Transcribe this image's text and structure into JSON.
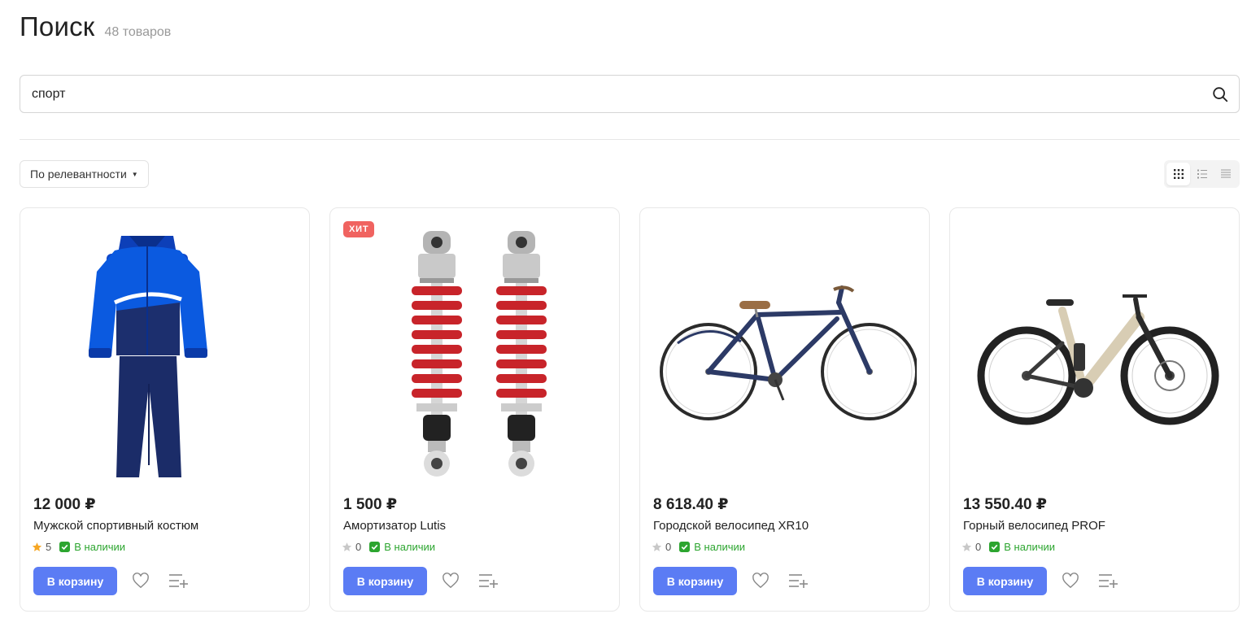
{
  "header": {
    "title": "Поиск",
    "count": "48 товаров"
  },
  "search": {
    "value": "спорт",
    "icon": "search-icon"
  },
  "toolbar": {
    "sort_label": "По релевантности",
    "views": [
      "grid-view-icon",
      "list-view-icon",
      "compact-view-icon"
    ],
    "active_view": "grid"
  },
  "colors": {
    "accent": "#5b7cf4",
    "badge": "#f06360",
    "in_stock": "#2ca52f",
    "star": "#f6a623",
    "star_empty": "#c8c8c8"
  },
  "products": [
    {
      "price": "12 000 ₽",
      "name": "Мужской спортивный костюм",
      "rating": "5",
      "stock": "В наличии",
      "cart_label": "В корзину",
      "badge": "",
      "image": "tracksuit-image"
    },
    {
      "price": "1 500 ₽",
      "name": "Амортизатор Lutis",
      "rating": "0",
      "stock": "В наличии",
      "cart_label": "В корзину",
      "badge": "ХИТ",
      "image": "shock-absorber-image"
    },
    {
      "price": "8 618.40 ₽",
      "name": "Городской велосипед XR10",
      "rating": "0",
      "stock": "В наличии",
      "cart_label": "В корзину",
      "badge": "",
      "image": "city-bike-image"
    },
    {
      "price": "13 550.40 ₽",
      "name": "Горный велосипед PROF",
      "rating": "0",
      "stock": "В наличии",
      "cart_label": "В корзину",
      "badge": "",
      "image": "mountain-bike-image"
    }
  ]
}
